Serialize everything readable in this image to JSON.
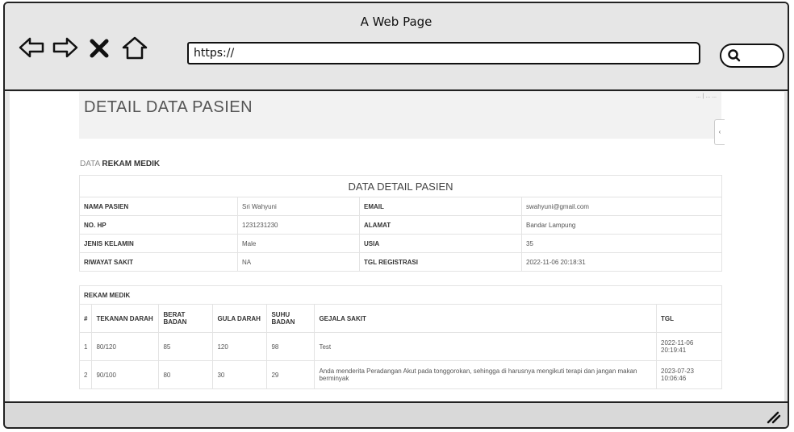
{
  "browser": {
    "window_title": "A Web Page",
    "url": "https://"
  },
  "page": {
    "title": "DETAIL DATA PASIEN",
    "breadcrumb": "... | ... ...",
    "side_button": "‹",
    "subtitle_prefix": "DATA",
    "subtitle_bold": "REKAM MEDIK"
  },
  "detail": {
    "caption": "DATA DETAIL PASIEN",
    "rows": [
      {
        "l1": "NAMA PASIEN",
        "v1": "Sri Wahyuni",
        "l2": "EMAIL",
        "v2": "swahyuni@gmail.com"
      },
      {
        "l1": "NO. HP",
        "v1": "1231231230",
        "l2": "ALAMAT",
        "v2": "Bandar Lampung"
      },
      {
        "l1": "JENIS KELAMIN",
        "v1": "Male",
        "l2": "USIA",
        "v2": "35"
      },
      {
        "l1": "RIWAYAT SAKIT",
        "v1": "NA",
        "l2": "TGL REGISTRASI",
        "v2": "2022-11-06 20:18:31"
      }
    ]
  },
  "rekam": {
    "caption": "REKAM MEDIK",
    "headers": [
      "#",
      "TEKANAN DARAH",
      "BERAT BADAN",
      "GULA DARAH",
      "SUHU BADAN",
      "GEJALA SAKIT",
      "TGL"
    ],
    "rows": [
      {
        "no": "1",
        "tekanan": "80/120",
        "berat": "85",
        "gula": "120",
        "suhu": "98",
        "gejala": "Test",
        "tgl": "2022-11-06 20:19:41"
      },
      {
        "no": "2",
        "tekanan": "90/100",
        "berat": "80",
        "gula": "30",
        "suhu": "29",
        "gejala": "Anda menderita Peradangan Akut pada tonggorokan, sehingga di harusnya mengikuti terapi dan jangan makan berminyak",
        "tgl": "2023-07-23 10:06:46"
      }
    ]
  },
  "icons": {
    "back": "arrow-left-icon",
    "forward": "arrow-right-icon",
    "stop": "close-icon",
    "home": "home-icon",
    "search": "search-icon",
    "resize": "resize-grip-icon"
  }
}
